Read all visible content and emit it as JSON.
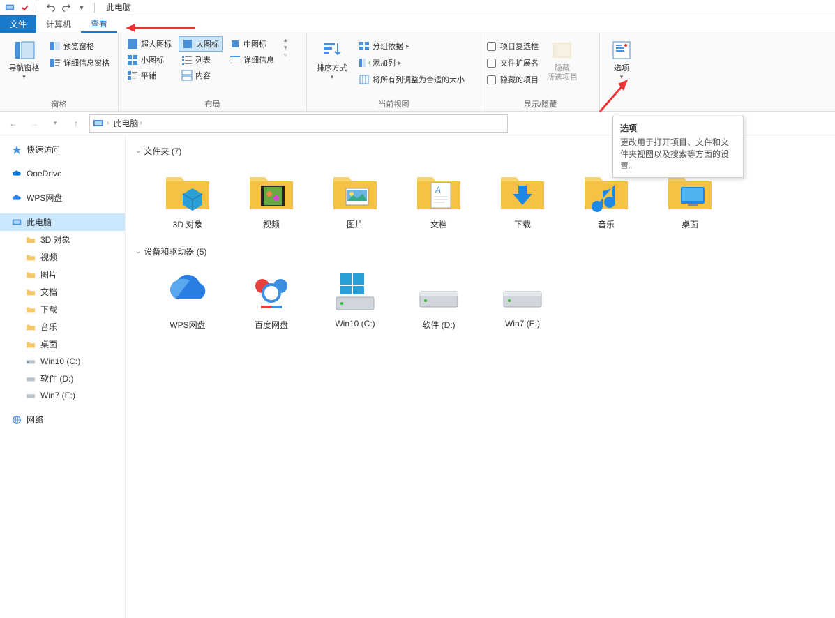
{
  "titlebar": {
    "title": "此电脑"
  },
  "tabs": {
    "file": "文件",
    "computer": "计算机",
    "view": "查看"
  },
  "ribbon": {
    "panes": {
      "label": "窗格",
      "nav_pane": "导航窗格",
      "preview": "预览窗格",
      "details": "详细信息窗格"
    },
    "layout": {
      "label": "布局",
      "extra_large": "超大图标",
      "large": "大图标",
      "medium": "中图标",
      "small": "小图标",
      "list": "列表",
      "details_view": "详细信息",
      "tiles": "平铺",
      "content": "内容"
    },
    "current_view": {
      "label": "当前视图",
      "sort": "排序方式",
      "group_by": "分组依据",
      "add_column": "添加列",
      "size_columns": "将所有列调整为合适的大小"
    },
    "show_hide": {
      "label": "显示/隐藏",
      "item_checkboxes": "项目复选框",
      "file_ext": "文件扩展名",
      "hidden_items": "隐藏的项目",
      "hide_selected": "隐藏\n所选项目"
    },
    "options": {
      "label": "选项"
    }
  },
  "tooltip": {
    "title": "选项",
    "body": "更改用于打开项目、文件和文件夹视图以及搜索等方面的设置。"
  },
  "address": {
    "root": "此电脑"
  },
  "sidebar": {
    "quick_access": "快速访问",
    "onedrive": "OneDrive",
    "wps": "WPS网盘",
    "this_pc": "此电脑",
    "network": "网络",
    "children": {
      "3d": "3D 对象",
      "video": "视频",
      "pictures": "图片",
      "documents": "文档",
      "downloads": "下载",
      "music": "音乐",
      "desktop": "桌面",
      "win10": "Win10 (C:)",
      "soft": "软件 (D:)",
      "win7": "Win7 (E:)"
    }
  },
  "content": {
    "folders_header": "文件夹 (7)",
    "devices_header": "设备和驱动器 (5)",
    "folders": {
      "3d": "3D 对象",
      "video": "视频",
      "pictures": "图片",
      "documents": "文档",
      "downloads": "下载",
      "music": "音乐",
      "desktop": "桌面"
    },
    "devices": {
      "wps": "WPS网盘",
      "baidu": "百度网盘",
      "win10": "Win10 (C:)",
      "soft": "软件 (D:)",
      "win7": "Win7 (E:)"
    }
  }
}
